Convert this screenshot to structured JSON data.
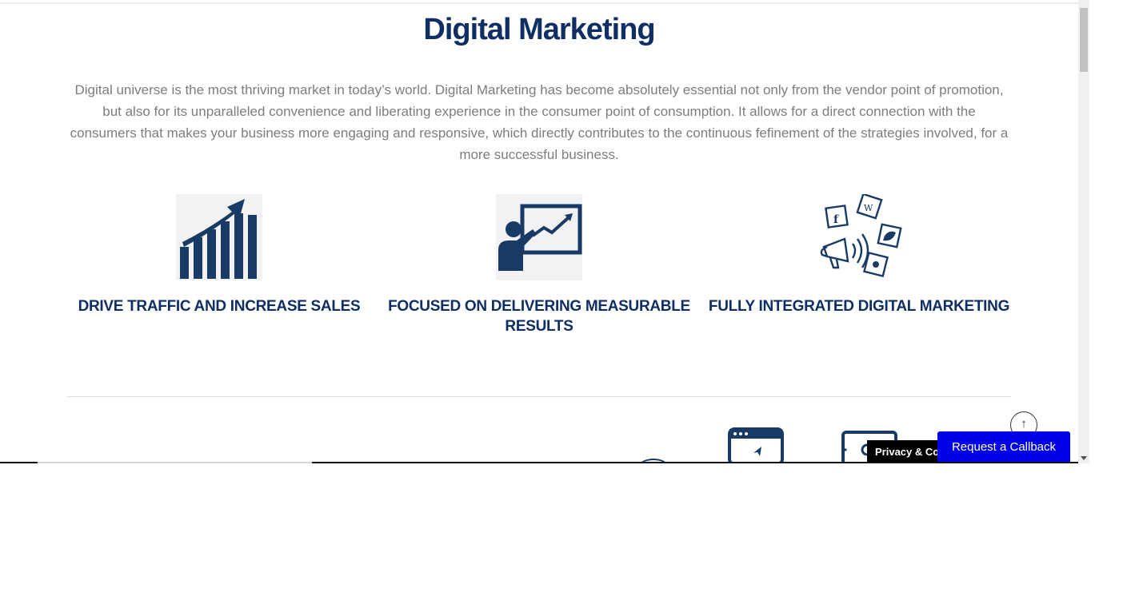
{
  "section": {
    "title": "Digital Marketing",
    "intro": "Digital universe is the most thriving market in today’s world. Digital Marketing has become absolutely essential not only from the vendor point of promotion, but also for its unparalleled convenience and liberating experience in the consumer point of consumption. It allows for a direct connection with the consumers that makes your business more engaging and responsive, which directly contributes to the continuous fefinement of the strategies involved, for a more successful business."
  },
  "features": [
    {
      "icon": "bar-chart-growth-icon",
      "label": "DRIVE TRAFFIC AND INCREASE SALES"
    },
    {
      "icon": "presentation-board-icon",
      "label": "FOCUSED ON DELIVERING MEASURABLE RESULTS"
    },
    {
      "icon": "megaphone-social-icon",
      "label": "FULLY INTEGRATED DIGITAL MARKETING"
    }
  ],
  "widgets": {
    "scroll_top_symbol": "↑",
    "privacy_label": "Privacy & Cookies Policy",
    "callback_label": "Request a Callback"
  },
  "colors": {
    "heading": "#0f2e63",
    "body_text": "#7d7d7d",
    "callback_bg": "#0000e6"
  }
}
